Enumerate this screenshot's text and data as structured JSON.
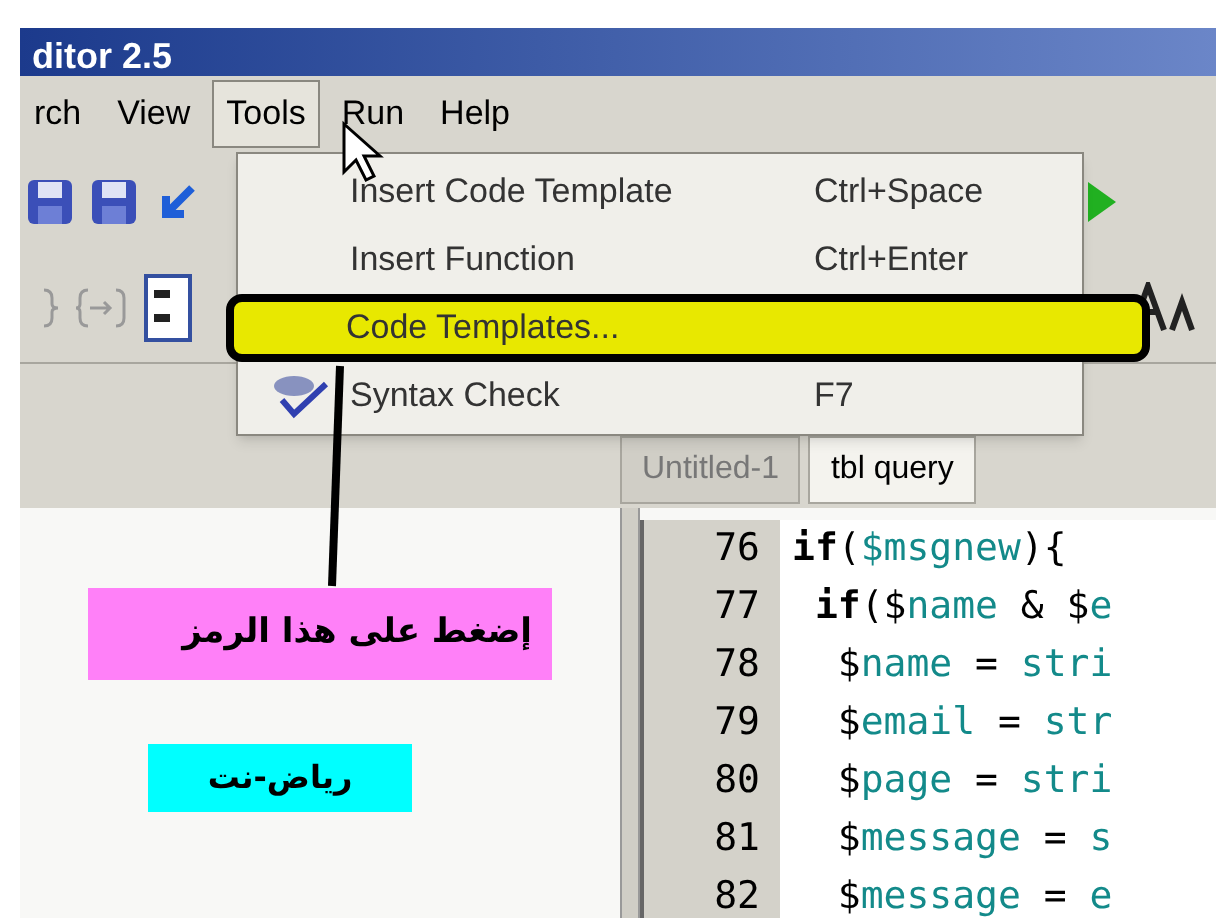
{
  "window": {
    "title": "ditor 2.5"
  },
  "menu_bar": [
    {
      "label": "rch",
      "selected": false
    },
    {
      "label": "View",
      "selected": false
    },
    {
      "label": "Tools",
      "selected": true
    },
    {
      "label": "Run",
      "selected": false
    },
    {
      "label": "Help",
      "selected": false
    }
  ],
  "tools_menu": {
    "items": [
      {
        "label": "Insert Code Template",
        "shortcut": "Ctrl+Space",
        "highlighted": false
      },
      {
        "label": "Insert Function",
        "shortcut": "Ctrl+Enter",
        "highlighted": false
      },
      {
        "label": "Code Templates...",
        "highlighted": true
      },
      {
        "label": "Syntax Check",
        "shortcut": "F7",
        "highlighted": false,
        "icon": true
      }
    ]
  },
  "tabs": [
    {
      "label": "Untitled-1",
      "selected": false
    },
    {
      "label": "tbl query",
      "selected": true
    }
  ],
  "annotation": {
    "callout": "إضغط على هذا الرمز",
    "credit": "رياض-نت"
  },
  "editor": {
    "lines": [
      {
        "number": "76",
        "tokens": [
          {
            "kind": "keyword",
            "text": "if"
          },
          {
            "kind": "plain",
            "text": "("
          },
          {
            "kind": "variable",
            "text": "$msgnew"
          },
          {
            "kind": "plain",
            "text": "){"
          }
        ]
      },
      {
        "number": "77",
        "tokens": [
          {
            "kind": "keyword",
            "text": " if"
          },
          {
            "kind": "plain",
            "text": "($"
          },
          {
            "kind": "variable",
            "text": "name"
          },
          {
            "kind": "plain",
            "text": " & $"
          },
          {
            "kind": "variable",
            "text": "e"
          }
        ]
      },
      {
        "number": "78",
        "tokens": [
          {
            "kind": "plain",
            "text": "  $"
          },
          {
            "kind": "variable",
            "text": "name"
          },
          {
            "kind": "plain",
            "text": " = "
          },
          {
            "kind": "variable",
            "text": "stri"
          }
        ]
      },
      {
        "number": "79",
        "tokens": [
          {
            "kind": "plain",
            "text": "  $"
          },
          {
            "kind": "variable",
            "text": "email"
          },
          {
            "kind": "plain",
            "text": " = "
          },
          {
            "kind": "variable",
            "text": "str"
          }
        ]
      },
      {
        "number": "80",
        "tokens": [
          {
            "kind": "plain",
            "text": "  $"
          },
          {
            "kind": "variable",
            "text": "page"
          },
          {
            "kind": "plain",
            "text": " = "
          },
          {
            "kind": "variable",
            "text": "stri"
          }
        ]
      },
      {
        "number": "81",
        "tokens": [
          {
            "kind": "plain",
            "text": "  $"
          },
          {
            "kind": "variable",
            "text": "message"
          },
          {
            "kind": "plain",
            "text": " = "
          },
          {
            "kind": "variable",
            "text": "s"
          }
        ]
      },
      {
        "number": "82",
        "tokens": [
          {
            "kind": "plain",
            "text": "  $"
          },
          {
            "kind": "variable",
            "text": "message"
          },
          {
            "kind": "plain",
            "text": " = "
          },
          {
            "kind": "variable",
            "text": "e"
          }
        ]
      }
    ]
  }
}
